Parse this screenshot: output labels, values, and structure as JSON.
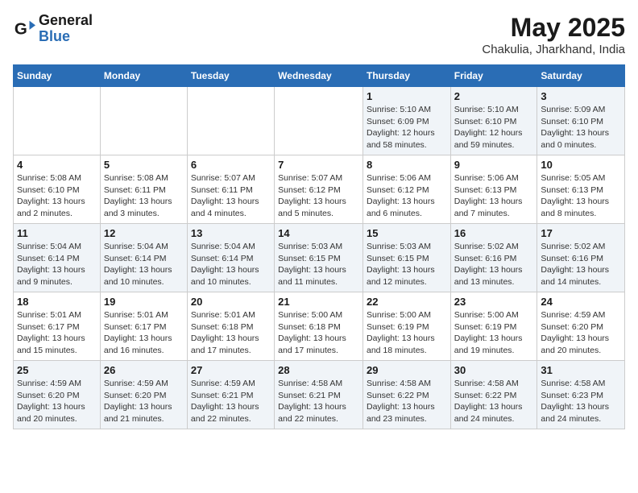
{
  "header": {
    "logo_general": "General",
    "logo_blue": "Blue",
    "month": "May 2025",
    "location": "Chakulia, Jharkhand, India"
  },
  "days_of_week": [
    "Sunday",
    "Monday",
    "Tuesday",
    "Wednesday",
    "Thursday",
    "Friday",
    "Saturday"
  ],
  "weeks": [
    [
      {
        "day": "",
        "info": ""
      },
      {
        "day": "",
        "info": ""
      },
      {
        "day": "",
        "info": ""
      },
      {
        "day": "",
        "info": ""
      },
      {
        "day": "1",
        "info": "Sunrise: 5:10 AM\nSunset: 6:09 PM\nDaylight: 12 hours\nand 58 minutes."
      },
      {
        "day": "2",
        "info": "Sunrise: 5:10 AM\nSunset: 6:10 PM\nDaylight: 12 hours\nand 59 minutes."
      },
      {
        "day": "3",
        "info": "Sunrise: 5:09 AM\nSunset: 6:10 PM\nDaylight: 13 hours\nand 0 minutes."
      }
    ],
    [
      {
        "day": "4",
        "info": "Sunrise: 5:08 AM\nSunset: 6:10 PM\nDaylight: 13 hours\nand 2 minutes."
      },
      {
        "day": "5",
        "info": "Sunrise: 5:08 AM\nSunset: 6:11 PM\nDaylight: 13 hours\nand 3 minutes."
      },
      {
        "day": "6",
        "info": "Sunrise: 5:07 AM\nSunset: 6:11 PM\nDaylight: 13 hours\nand 4 minutes."
      },
      {
        "day": "7",
        "info": "Sunrise: 5:07 AM\nSunset: 6:12 PM\nDaylight: 13 hours\nand 5 minutes."
      },
      {
        "day": "8",
        "info": "Sunrise: 5:06 AM\nSunset: 6:12 PM\nDaylight: 13 hours\nand 6 minutes."
      },
      {
        "day": "9",
        "info": "Sunrise: 5:06 AM\nSunset: 6:13 PM\nDaylight: 13 hours\nand 7 minutes."
      },
      {
        "day": "10",
        "info": "Sunrise: 5:05 AM\nSunset: 6:13 PM\nDaylight: 13 hours\nand 8 minutes."
      }
    ],
    [
      {
        "day": "11",
        "info": "Sunrise: 5:04 AM\nSunset: 6:14 PM\nDaylight: 13 hours\nand 9 minutes."
      },
      {
        "day": "12",
        "info": "Sunrise: 5:04 AM\nSunset: 6:14 PM\nDaylight: 13 hours\nand 10 minutes."
      },
      {
        "day": "13",
        "info": "Sunrise: 5:04 AM\nSunset: 6:14 PM\nDaylight: 13 hours\nand 10 minutes."
      },
      {
        "day": "14",
        "info": "Sunrise: 5:03 AM\nSunset: 6:15 PM\nDaylight: 13 hours\nand 11 minutes."
      },
      {
        "day": "15",
        "info": "Sunrise: 5:03 AM\nSunset: 6:15 PM\nDaylight: 13 hours\nand 12 minutes."
      },
      {
        "day": "16",
        "info": "Sunrise: 5:02 AM\nSunset: 6:16 PM\nDaylight: 13 hours\nand 13 minutes."
      },
      {
        "day": "17",
        "info": "Sunrise: 5:02 AM\nSunset: 6:16 PM\nDaylight: 13 hours\nand 14 minutes."
      }
    ],
    [
      {
        "day": "18",
        "info": "Sunrise: 5:01 AM\nSunset: 6:17 PM\nDaylight: 13 hours\nand 15 minutes."
      },
      {
        "day": "19",
        "info": "Sunrise: 5:01 AM\nSunset: 6:17 PM\nDaylight: 13 hours\nand 16 minutes."
      },
      {
        "day": "20",
        "info": "Sunrise: 5:01 AM\nSunset: 6:18 PM\nDaylight: 13 hours\nand 17 minutes."
      },
      {
        "day": "21",
        "info": "Sunrise: 5:00 AM\nSunset: 6:18 PM\nDaylight: 13 hours\nand 17 minutes."
      },
      {
        "day": "22",
        "info": "Sunrise: 5:00 AM\nSunset: 6:19 PM\nDaylight: 13 hours\nand 18 minutes."
      },
      {
        "day": "23",
        "info": "Sunrise: 5:00 AM\nSunset: 6:19 PM\nDaylight: 13 hours\nand 19 minutes."
      },
      {
        "day": "24",
        "info": "Sunrise: 4:59 AM\nSunset: 6:20 PM\nDaylight: 13 hours\nand 20 minutes."
      }
    ],
    [
      {
        "day": "25",
        "info": "Sunrise: 4:59 AM\nSunset: 6:20 PM\nDaylight: 13 hours\nand 20 minutes."
      },
      {
        "day": "26",
        "info": "Sunrise: 4:59 AM\nSunset: 6:20 PM\nDaylight: 13 hours\nand 21 minutes."
      },
      {
        "day": "27",
        "info": "Sunrise: 4:59 AM\nSunset: 6:21 PM\nDaylight: 13 hours\nand 22 minutes."
      },
      {
        "day": "28",
        "info": "Sunrise: 4:58 AM\nSunset: 6:21 PM\nDaylight: 13 hours\nand 22 minutes."
      },
      {
        "day": "29",
        "info": "Sunrise: 4:58 AM\nSunset: 6:22 PM\nDaylight: 13 hours\nand 23 minutes."
      },
      {
        "day": "30",
        "info": "Sunrise: 4:58 AM\nSunset: 6:22 PM\nDaylight: 13 hours\nand 24 minutes."
      },
      {
        "day": "31",
        "info": "Sunrise: 4:58 AM\nSunset: 6:23 PM\nDaylight: 13 hours\nand 24 minutes."
      }
    ]
  ]
}
